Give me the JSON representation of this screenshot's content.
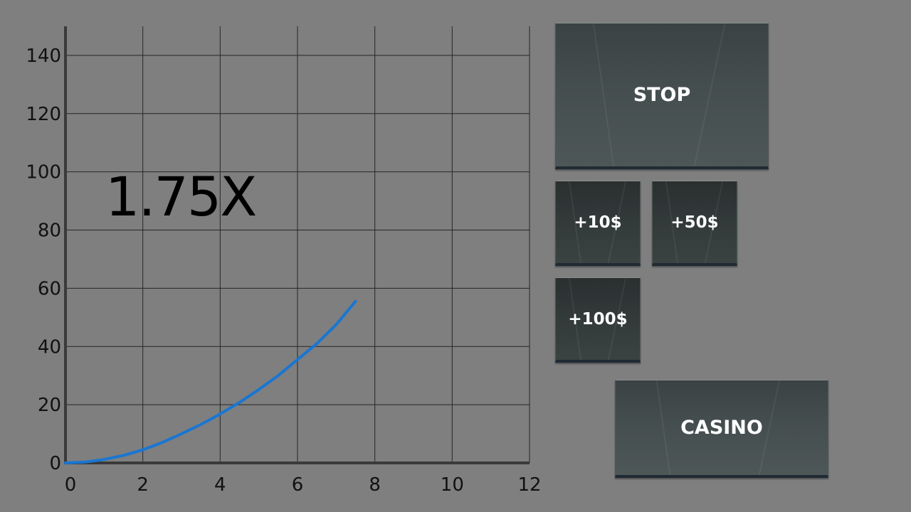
{
  "game": {
    "multiplier": "1.75X"
  },
  "buttons": {
    "stop": "STOP",
    "add10": "+10$",
    "add50": "+50$",
    "add100": "+100$",
    "casino": "CASINO"
  },
  "colors": {
    "background": "#7f7f7f",
    "curve": "#1976d2",
    "grid": "#262626",
    "axis": "#3a3a3a"
  },
  "chart_data": {
    "type": "line",
    "title": "",
    "xlabel": "",
    "ylabel": "",
    "xlim": [
      0,
      12
    ],
    "ylim": [
      0,
      150
    ],
    "x_ticks": [
      0,
      2,
      4,
      6,
      8,
      10,
      12
    ],
    "y_ticks": [
      0,
      20,
      40,
      60,
      80,
      100,
      120,
      140
    ],
    "grid": true,
    "series": [
      {
        "x": [
          0,
          0.5,
          1,
          1.5,
          2,
          2.5,
          3,
          3.5,
          4,
          4.5,
          5,
          5.5,
          6,
          6.5,
          7,
          7.5
        ],
        "values": [
          0,
          0.3,
          1.2,
          2.6,
          4.5,
          7,
          10,
          13.2,
          16.8,
          20.8,
          25.2,
          30,
          35.5,
          41,
          47.5,
          55.5
        ]
      }
    ]
  }
}
